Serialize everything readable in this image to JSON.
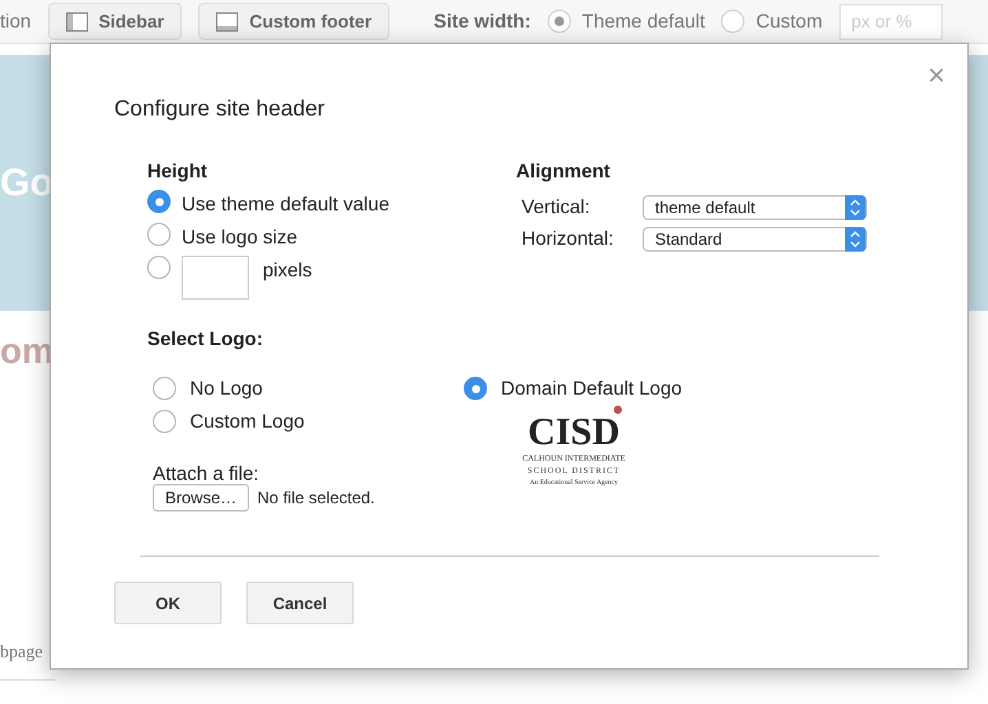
{
  "toolbar": {
    "cut_label": "tion",
    "buttons": [
      {
        "label": "Sidebar",
        "kind": "sidebar"
      },
      {
        "label": "Custom footer",
        "kind": "footer"
      }
    ],
    "site_width": {
      "label": "Site width:",
      "options": [
        {
          "label": "Theme default",
          "selected": true
        },
        {
          "label": "Custom",
          "selected": false
        }
      ],
      "placeholder": "px or %"
    }
  },
  "background": {
    "heading_cut": "Go",
    "subheading_cut": "om",
    "footer_cut": "bpage"
  },
  "dialog": {
    "title": "Configure site header",
    "close": "×",
    "height": {
      "title": "Height",
      "options": [
        {
          "label": "Use theme default value",
          "kind": "plain",
          "selected": true
        },
        {
          "label": "Use logo size",
          "kind": "plain",
          "selected": false
        },
        {
          "label": "pixels",
          "kind": "pixels",
          "selected": false
        }
      ]
    },
    "alignment": {
      "title": "Alignment",
      "fields": [
        {
          "label": "Vertical:",
          "value": "theme default"
        },
        {
          "label": "Horizontal:",
          "value": "Standard"
        }
      ]
    },
    "logo": {
      "title": "Select Logo:",
      "options": [
        {
          "label": "No Logo",
          "selected": false
        },
        {
          "label": "Custom Logo",
          "selected": false
        },
        {
          "label": "Domain Default Logo",
          "selected": true
        }
      ],
      "attach_label": "Attach a file:",
      "browse": "Browse…",
      "file_status": "No file selected.",
      "logo_text": [
        "CISD",
        "CALHOUN INTERMEDIATE",
        "SCHOOL DISTRICT",
        "An Educational Service Agency"
      ]
    },
    "buttons": [
      "OK",
      "Cancel"
    ]
  }
}
